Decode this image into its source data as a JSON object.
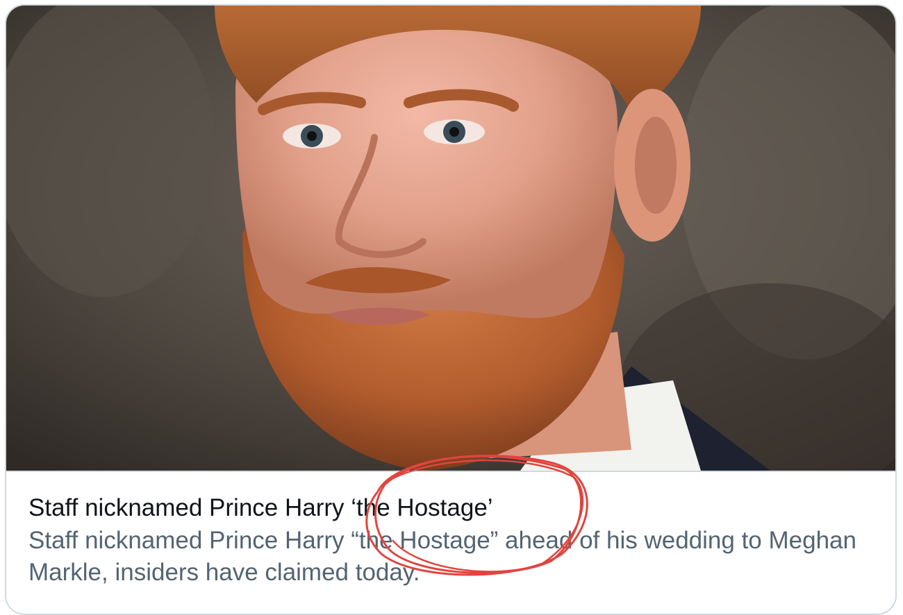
{
  "link_card": {
    "title": "Staff nicknamed Prince Harry ‘the Hostage’",
    "description": "Staff nicknamed Prince Harry “the Hostage” ahead of his wedding to Meghan Markle, insiders have claimed today.",
    "image": {
      "icon": "photo-of-man-with-red-beard"
    }
  },
  "colors": {
    "title_text": "#0f1419",
    "description_text": "#536471",
    "card_border": "#cfd9de",
    "annotation_circle": "#e0453f"
  }
}
